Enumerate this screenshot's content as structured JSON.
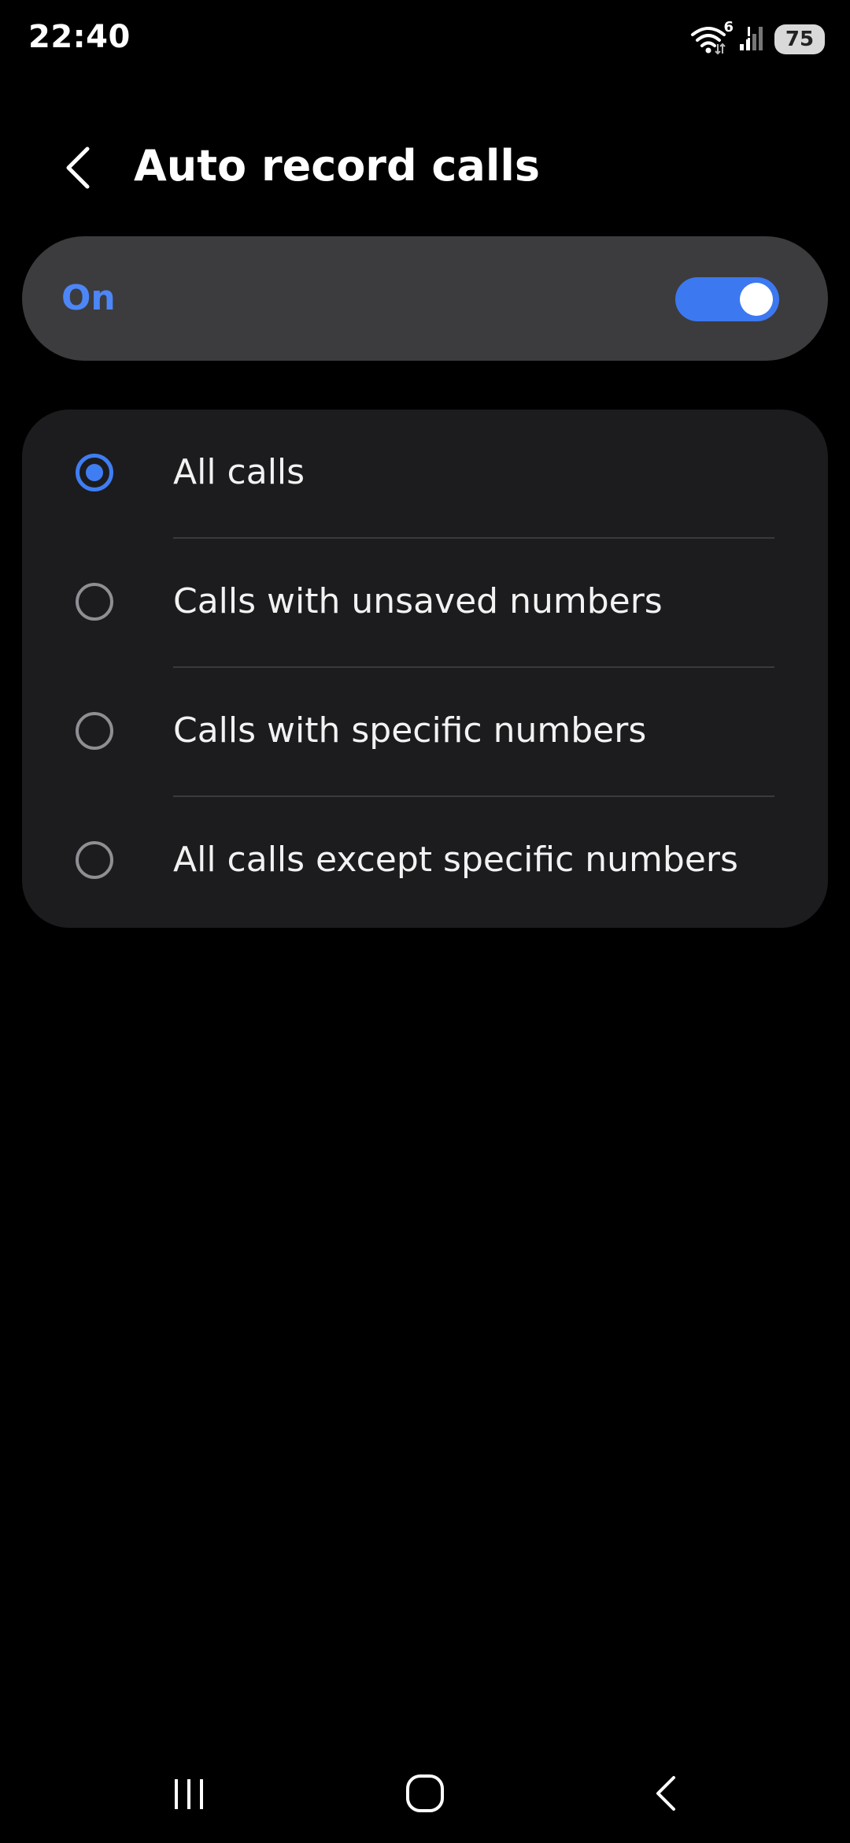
{
  "status_bar": {
    "time": "22:40",
    "wifi_badge": "6",
    "battery": "75"
  },
  "header": {
    "title": "Auto record calls"
  },
  "master_switch": {
    "label": "On",
    "state": "on",
    "accent_color": "#3c78f0"
  },
  "options": [
    {
      "label": "All calls",
      "selected": true
    },
    {
      "label": "Calls with unsaved numbers",
      "selected": false
    },
    {
      "label": "Calls with specific numbers",
      "selected": false
    },
    {
      "label": "All calls except specific numbers",
      "selected": false
    }
  ],
  "nav_bar": {
    "icons": [
      "recents-icon",
      "home-icon",
      "back-icon"
    ]
  }
}
